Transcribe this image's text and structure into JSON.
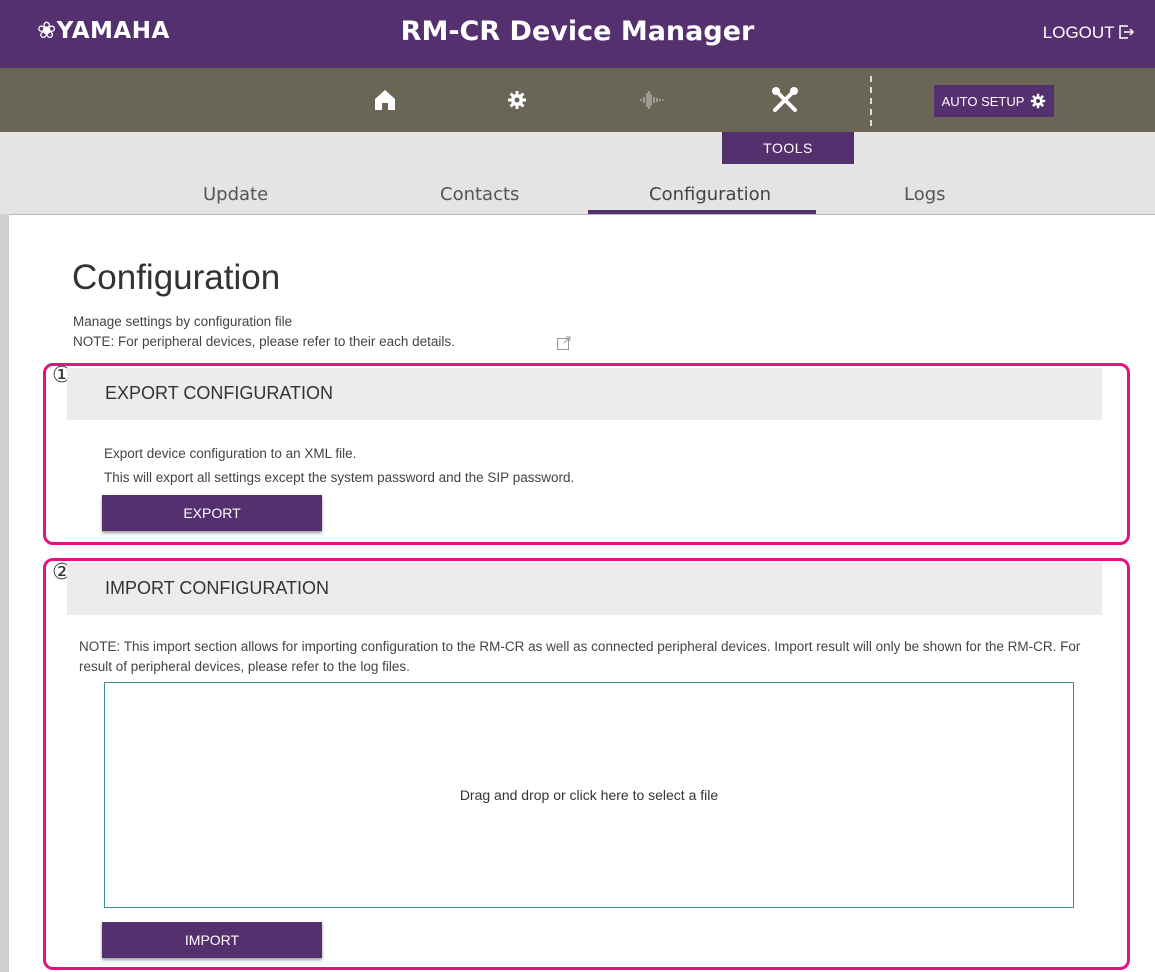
{
  "header": {
    "logo": "❀YAMAHA",
    "title": "RM-CR Device Manager",
    "logout": "LOGOUT"
  },
  "nav": {
    "icons": [
      "home-icon",
      "gear-icon",
      "audio-wave-icon",
      "tools-icon"
    ],
    "auto_setup": "AUTO SETUP"
  },
  "tabs": {
    "section": "TOOLS",
    "items": [
      "Update",
      "Contacts",
      "Configuration",
      "Logs"
    ],
    "active": "Configuration"
  },
  "page": {
    "title": "Configuration",
    "description": "Manage settings by configuration file",
    "note": "NOTE: For peripheral devices, please refer to their each details."
  },
  "export": {
    "marker": "①",
    "title": "EXPORT CONFIGURATION",
    "line1": "Export device configuration to an XML file.",
    "line2": "This will export all settings except the system password and the SIP password.",
    "button": "EXPORT"
  },
  "import": {
    "marker": "②",
    "title": "IMPORT CONFIGURATION",
    "note": "NOTE: This import section allows for importing configuration to the RM-CR as well as connected peripheral devices. Import result will only be shown for the RM-CR. For result of peripheral devices, please refer to the log files.",
    "dropzone": "Drag and drop or click here to select a file",
    "button": "IMPORT"
  },
  "colors": {
    "brand": "#55306e",
    "navbar": "#6a6656",
    "highlight": "#e2137f"
  }
}
